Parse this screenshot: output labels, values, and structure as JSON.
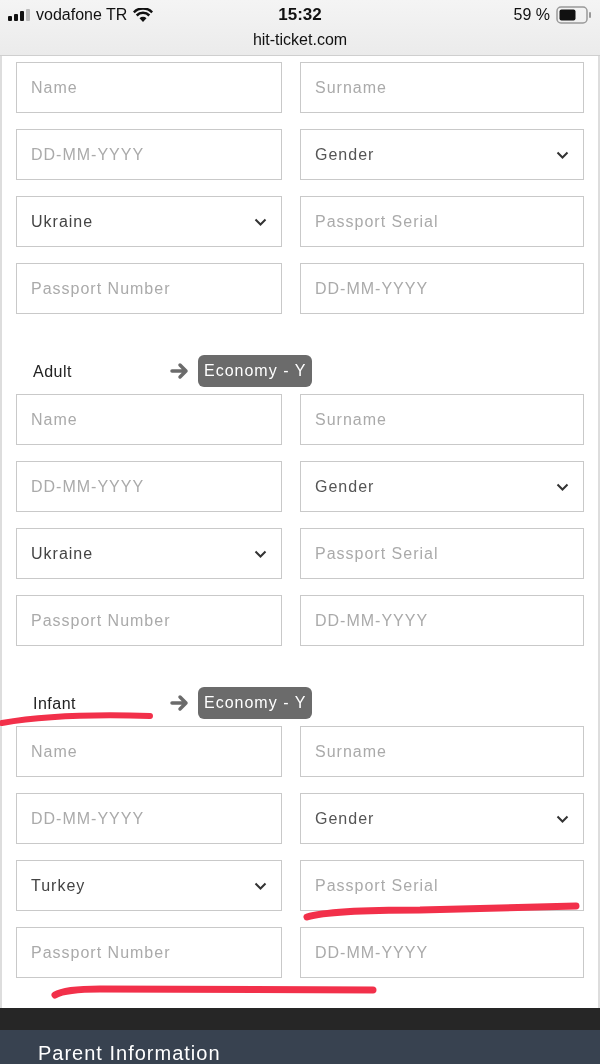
{
  "status_bar": {
    "carrier": "vodafone TR",
    "time": "15:32",
    "battery": "59 %",
    "url": "hit-ticket.com"
  },
  "passengers": [
    {
      "fields": [
        {
          "kind": "text",
          "placeholder": "Name"
        },
        {
          "kind": "text",
          "placeholder": "Surname"
        },
        {
          "kind": "text",
          "placeholder": "DD-MM-YYYY"
        },
        {
          "kind": "select",
          "placeholder": "Gender"
        },
        {
          "kind": "select",
          "value": "Ukraine"
        },
        {
          "kind": "text",
          "placeholder": "Passport Serial"
        },
        {
          "kind": "text",
          "placeholder": "Passport Number"
        },
        {
          "kind": "text",
          "placeholder": "DD-MM-YYYY"
        }
      ]
    },
    {
      "type": "Adult",
      "class": "Economy - Y",
      "fields": [
        {
          "kind": "text",
          "placeholder": "Name"
        },
        {
          "kind": "text",
          "placeholder": "Surname"
        },
        {
          "kind": "text",
          "placeholder": "DD-MM-YYYY"
        },
        {
          "kind": "select",
          "placeholder": "Gender"
        },
        {
          "kind": "select",
          "value": "Ukraine"
        },
        {
          "kind": "text",
          "placeholder": "Passport Serial"
        },
        {
          "kind": "text",
          "placeholder": "Passport Number"
        },
        {
          "kind": "text",
          "placeholder": "DD-MM-YYYY"
        }
      ]
    },
    {
      "type": "Infant",
      "class": "Economy - Y",
      "fields": [
        {
          "kind": "text",
          "placeholder": "Name"
        },
        {
          "kind": "text",
          "placeholder": "Surname"
        },
        {
          "kind": "text",
          "placeholder": "DD-MM-YYYY"
        },
        {
          "kind": "select",
          "placeholder": "Gender"
        },
        {
          "kind": "select",
          "value": "Turkey"
        },
        {
          "kind": "text",
          "placeholder": "Passport Serial"
        },
        {
          "kind": "text",
          "placeholder": "Passport Number"
        },
        {
          "kind": "text",
          "placeholder": "DD-MM-YYYY"
        }
      ]
    }
  ],
  "section_title": "Parent Information"
}
